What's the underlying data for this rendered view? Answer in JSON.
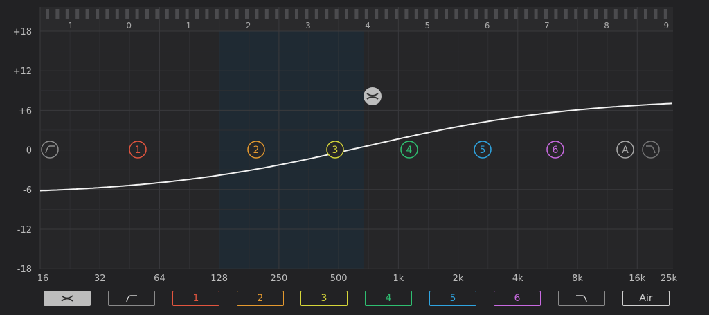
{
  "eq": {
    "db_labels": [
      "+18",
      "+12",
      "+6",
      "0",
      "-6",
      "-12",
      "-18"
    ],
    "freq_labels": [
      "16",
      "32",
      "64",
      "128",
      "250",
      "500",
      "1k",
      "2k",
      "4k",
      "8k",
      "16k",
      "25k"
    ],
    "top_labels": [
      "-1",
      "0",
      "1",
      "2",
      "3",
      "4",
      "5",
      "6",
      "7",
      "8",
      "9"
    ],
    "nodes": [
      {
        "id": "hp",
        "icon": "highpass-icon",
        "color": "#8e8e8e"
      },
      {
        "id": "b1",
        "label": "1",
        "color": "#e2553f"
      },
      {
        "id": "b2",
        "label": "2",
        "color": "#e59a2f"
      },
      {
        "id": "b3",
        "label": "3",
        "color": "#d6d63a"
      },
      {
        "id": "b4",
        "label": "4",
        "color": "#2fbf71"
      },
      {
        "id": "b5",
        "label": "5",
        "color": "#2fa4e0"
      },
      {
        "id": "b6",
        "label": "6",
        "color": "#c86ae0"
      },
      {
        "id": "air",
        "label": "A",
        "color": "#a8a8a8"
      },
      {
        "id": "lp",
        "icon": "lowpass-icon",
        "color": "#777777"
      }
    ],
    "tilt_handle": {
      "icon": "tilt-icon",
      "color": "#bdbdbd"
    },
    "curve_color": "#f2f2f2",
    "highlight_color": "#1f2a33"
  },
  "toolbar": {
    "buttons": [
      {
        "id": "tilt",
        "icon": "tilt-icon",
        "active": true
      },
      {
        "id": "hp",
        "icon": "highpass-icon"
      },
      {
        "id": "b1",
        "label": "1",
        "color": "#e2553f"
      },
      {
        "id": "b2",
        "label": "2",
        "color": "#e59a2f"
      },
      {
        "id": "b3",
        "label": "3",
        "color": "#d6d63a"
      },
      {
        "id": "b4",
        "label": "4",
        "color": "#2fbf71"
      },
      {
        "id": "b5",
        "label": "5",
        "color": "#2fa4e0"
      },
      {
        "id": "b6",
        "label": "6",
        "color": "#c86ae0"
      },
      {
        "id": "lp",
        "icon": "lowpass-icon"
      },
      {
        "id": "air",
        "label": "Air",
        "color": "#cfcfcf"
      }
    ]
  }
}
